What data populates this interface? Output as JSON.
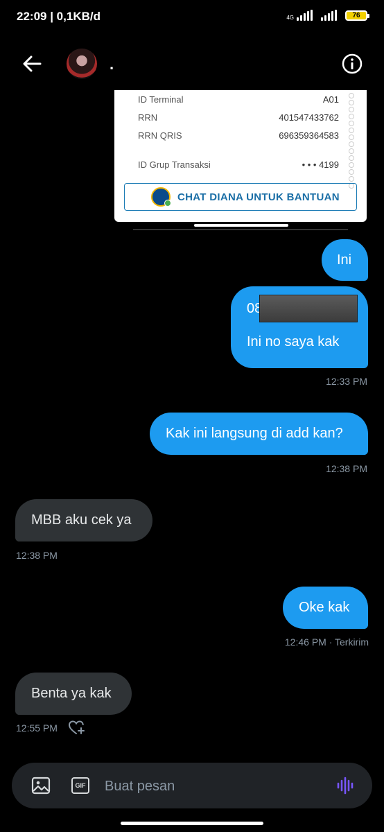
{
  "status_bar": {
    "time_data": "22:09 | 0,1KB/d",
    "network": "4G",
    "battery": "76"
  },
  "header": {
    "contact_name": "."
  },
  "receipt": {
    "rows": [
      {
        "label": "ID Terminal",
        "value": "A01"
      },
      {
        "label": "RRN",
        "value": "401547433762"
      },
      {
        "label": "RRN QRIS",
        "value": "696359364583"
      },
      {
        "label": "ID Grup Transaksi",
        "value": "• • • 4199"
      }
    ],
    "help_button": "CHAT DIANA UNTUK BANTUAN"
  },
  "messages": [
    {
      "text": "Ini"
    },
    {
      "text_prefix": "08",
      "text_line2": "Ini no saya kak",
      "timestamp": "12:33 PM"
    },
    {
      "text": "Kak ini langsung di add kan?",
      "timestamp": "12:38 PM"
    },
    {
      "text": "MBB aku cek ya",
      "timestamp": "12:38 PM"
    },
    {
      "text": "Oke kak",
      "timestamp": "12:46 PM · Terkirim"
    },
    {
      "text": "Benta ya kak",
      "timestamp": "12:55 PM"
    }
  ],
  "composer": {
    "placeholder": "Buat pesan",
    "gif_label": "GIF"
  }
}
